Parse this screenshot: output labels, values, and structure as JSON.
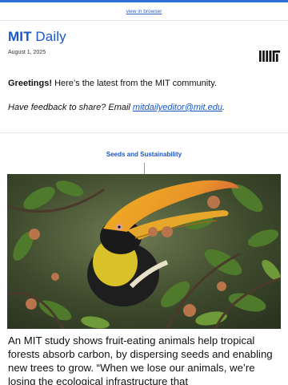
{
  "top_link": "view in browser",
  "header": {
    "brand_bold": "MIT",
    "brand_rest": " Daily",
    "date": "August 1, 2025"
  },
  "greeting": {
    "bold": "Greetings!",
    "rest": " Here’s the latest from the MIT community."
  },
  "feedback": {
    "text": "Have feedback to share? Email ",
    "email": "mitdailyeditor@mit.edu",
    "end": "."
  },
  "section": {
    "label": "Seeds and Sustainability"
  },
  "story": {
    "text": "An MIT study shows fruit-eating animals help tropical forests absorb carbon, by dispersing seeds and enabling new trees to grow. “When we lose our animals, we’re losing the ecological infrastructure that"
  },
  "icons": {
    "logo": "mit-logo",
    "hero": "hornbill-photo"
  },
  "colors": {
    "accent": "#1a56c6",
    "topbar": "#2f6fd6"
  }
}
